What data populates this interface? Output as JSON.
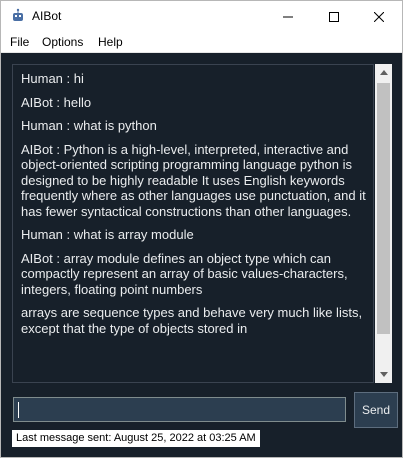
{
  "window": {
    "title": "AIBot",
    "icon": "robot-icon",
    "controls": [
      "minimize-icon",
      "maximize-icon",
      "close-icon"
    ]
  },
  "menu": {
    "file": "File",
    "options": "Options",
    "help": "Help"
  },
  "chat": {
    "messages": [
      "Human : hi",
      "AIBot : hello",
      "Human : what is python",
      "AIBot : Python is a high-level, interpreted, interactive and object-oriented scripting programming language python is designed to be highly readable It uses English keywords frequently where as other languages use punctuation, and it has fewer syntactical constructions than other languages.",
      "Human : what is array module",
      "AIBot : array module defines an object type which can compactly represent an array of basic values-characters, integers, floating point numbers",
      "arrays are sequence types and behave very much like lists, except that the type of objects stored in"
    ]
  },
  "input": {
    "value": "",
    "placeholder": ""
  },
  "send": {
    "label": "Send"
  },
  "status": {
    "text": "Last message sent: August 25, 2022 at 03:25 AM"
  },
  "colors": {
    "background": "#17202a",
    "input_background": "#2c3e50",
    "text": "#eaecee"
  }
}
